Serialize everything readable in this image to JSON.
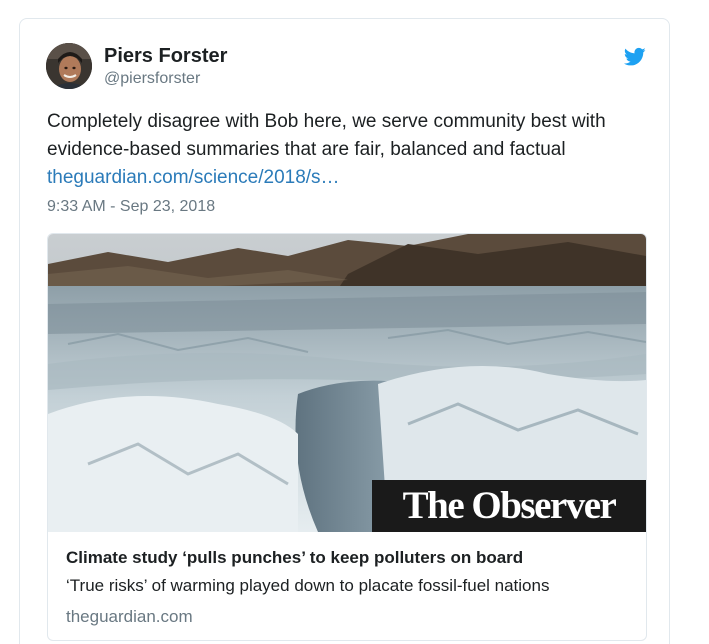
{
  "tweet": {
    "author_name": "Piers Forster",
    "author_handle": "@piersforster",
    "text_line1": "Completely disagree with Bob here, we serve community best with",
    "text_line2": "evidence-based summaries that are fair, balanced and factual",
    "link_text": "theguardian.com/science/2018/s…",
    "timestamp": "9:33 AM - Sep 23, 2018",
    "avatar_icon": "avatar-photo",
    "brand_icon": "twitter-bird-icon",
    "brand_color": "#1da1f2",
    "link_color": "#2b7bb9"
  },
  "card": {
    "image_icon": "glacier-photo",
    "logo_text": "The Observer",
    "title": "Climate study ‘pulls punches’ to keep polluters on board",
    "description": "‘True risks’ of warming played down to placate fossil-fuel nations",
    "domain": "theguardian.com"
  }
}
